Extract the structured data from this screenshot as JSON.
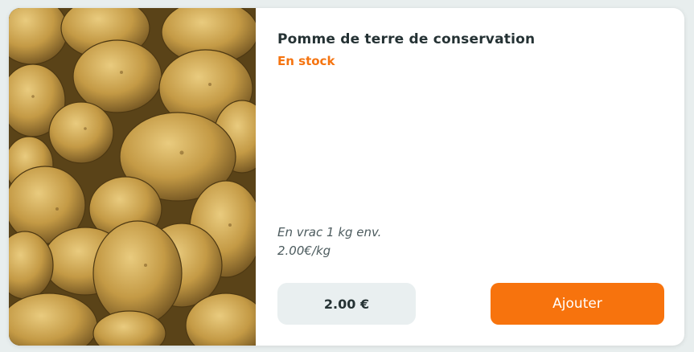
{
  "product": {
    "image_icon": "potatoes-photo",
    "title": "Pomme de terre de conservation",
    "stock_status": "En stock",
    "description_line1": "En vrac 1 kg env.",
    "description_line2": "2.00€/kg",
    "price": "2.00 €",
    "add_label": "Ajouter"
  },
  "colors": {
    "accent": "#f7730d",
    "title": "#253234",
    "price_bg": "#e9eff0"
  }
}
